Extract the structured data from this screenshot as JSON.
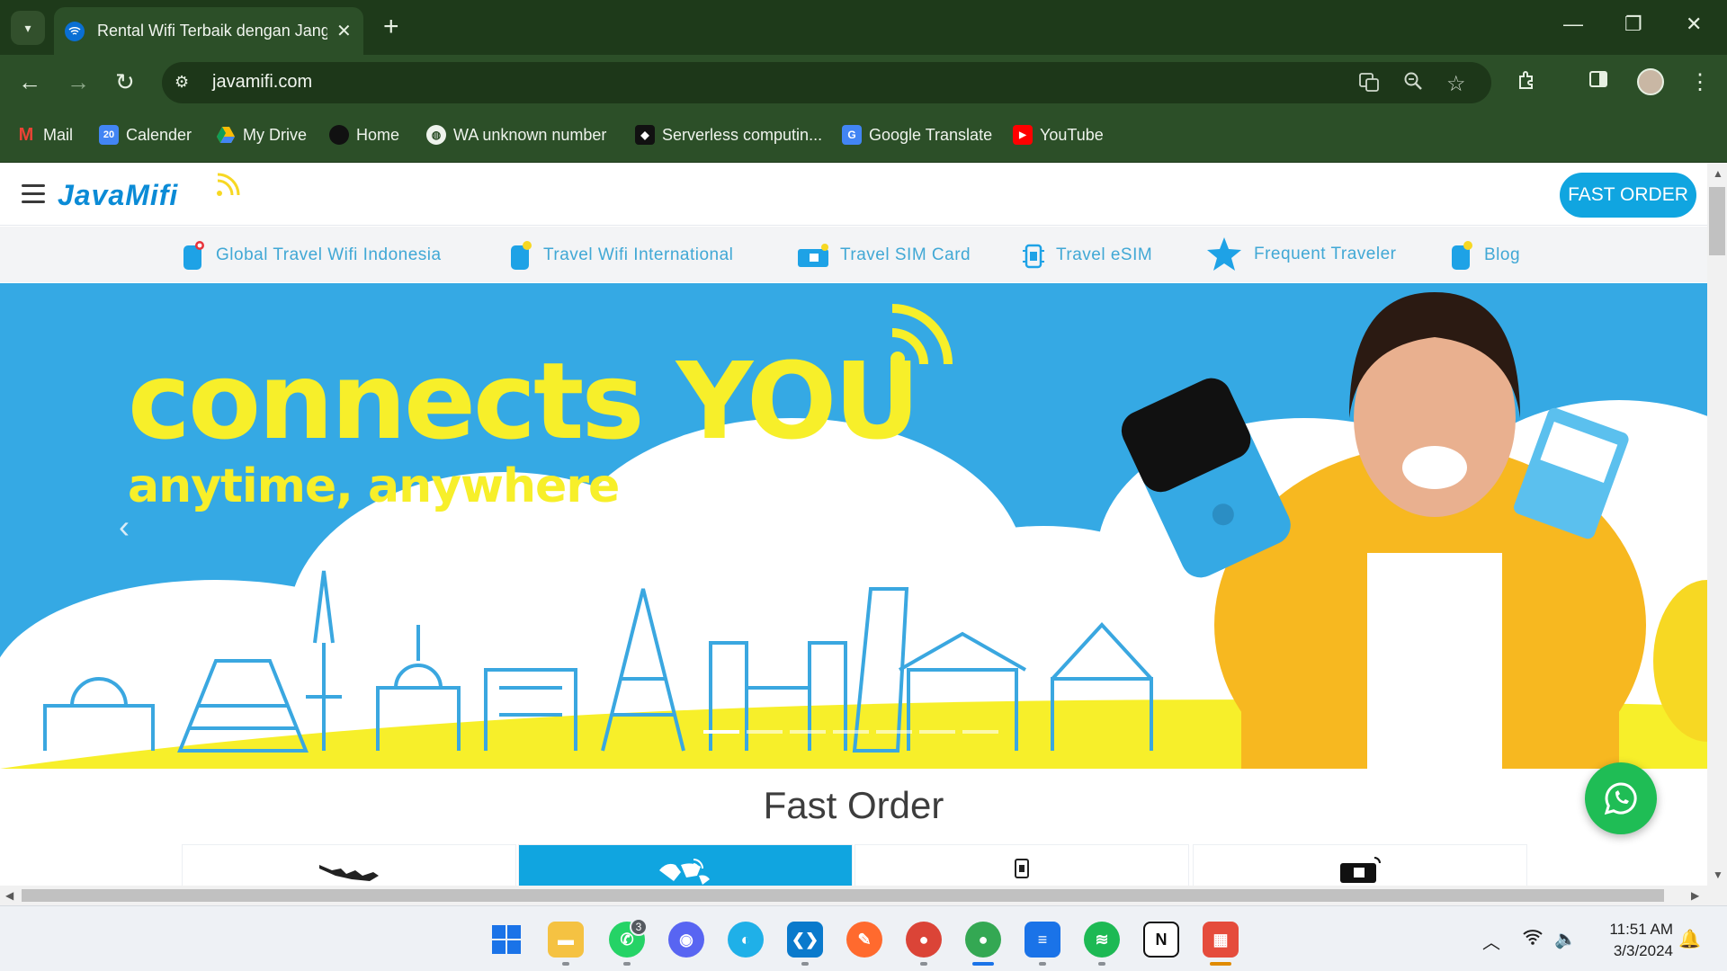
{
  "browser": {
    "tab_title": "Rental Wifi Terbaik dengan Jang",
    "url": "javamifi.com",
    "new_tab_glyph": "+",
    "icons": [
      "tab-search-icon",
      "wifi-favicon",
      "close-icon",
      "new-tab-icon",
      "minimize-icon",
      "restore-icon",
      "close-window-icon",
      "back-icon",
      "forward-icon",
      "reload-icon",
      "site-info-icon",
      "translate-icon",
      "zoom-icon",
      "bookmark-star-icon",
      "extensions-icon",
      "side-panel-icon",
      "profile-avatar",
      "menu-icon"
    ]
  },
  "bookmarks": [
    {
      "label": "Mail",
      "icon": "gmail-icon",
      "color": "#ea4335"
    },
    {
      "label": "Calender",
      "icon": "calendar-icon",
      "color": "#4285f4"
    },
    {
      "label": "My Drive",
      "icon": "drive-icon",
      "color": "#34a853"
    },
    {
      "label": "Home",
      "icon": "home-icon",
      "color": "#222222"
    },
    {
      "label": "WA unknown number",
      "icon": "globe-icon",
      "color": "#ffffff"
    },
    {
      "label": "Serverless computin...",
      "icon": "serverless-icon",
      "color": "#111111"
    },
    {
      "label": "Google Translate",
      "icon": "translate-icon",
      "color": "#4285f4"
    },
    {
      "label": "YouTube",
      "icon": "youtube-icon",
      "color": "#ff0000"
    }
  ],
  "site": {
    "logo": "JavaMifi",
    "fast_order_button": "FAST ORDER",
    "accent": "#10a5e0",
    "nav": [
      {
        "label": "Global Travel Wifi Indonesia",
        "icon": "pocket-wifi-icon"
      },
      {
        "label": "Travel Wifi International",
        "icon": "pocket-wifi-icon"
      },
      {
        "label": "Travel SIM Card",
        "icon": "sim-card-icon"
      },
      {
        "label": "Travel eSIM",
        "icon": "esim-chip-icon"
      },
      {
        "label": "Frequent Traveler",
        "icon": "star-icon"
      },
      {
        "label": "Blog",
        "icon": "pocket-wifi-icon"
      }
    ],
    "hero": {
      "title": "connects YOU",
      "subtitle": "anytime, anywhere",
      "slide_count": 7,
      "active_slide": 1
    },
    "section_title": "Fast Order",
    "order_tabs": [
      {
        "icon": "indonesia-map-icon",
        "active": false
      },
      {
        "icon": "world-map-icon",
        "active": true
      },
      {
        "icon": "esim-chip-icon",
        "active": false
      },
      {
        "icon": "sim-card-icon",
        "active": false
      }
    ],
    "whatsapp_fab": "whatsapp-icon"
  },
  "taskbar": {
    "apps": [
      "windows-start-icon",
      "file-explorer-icon",
      "whatsapp-icon",
      "discord-icon",
      "evernote-icon",
      "vscode-icon",
      "pen-app-icon",
      "chrome-icon",
      "chrome-profile-icon",
      "notepad-icon",
      "spotify-icon",
      "notion-icon",
      "calendar-app-icon"
    ],
    "whatsapp_badge": "3",
    "time": "11:51 AM",
    "date": "3/3/2024"
  }
}
